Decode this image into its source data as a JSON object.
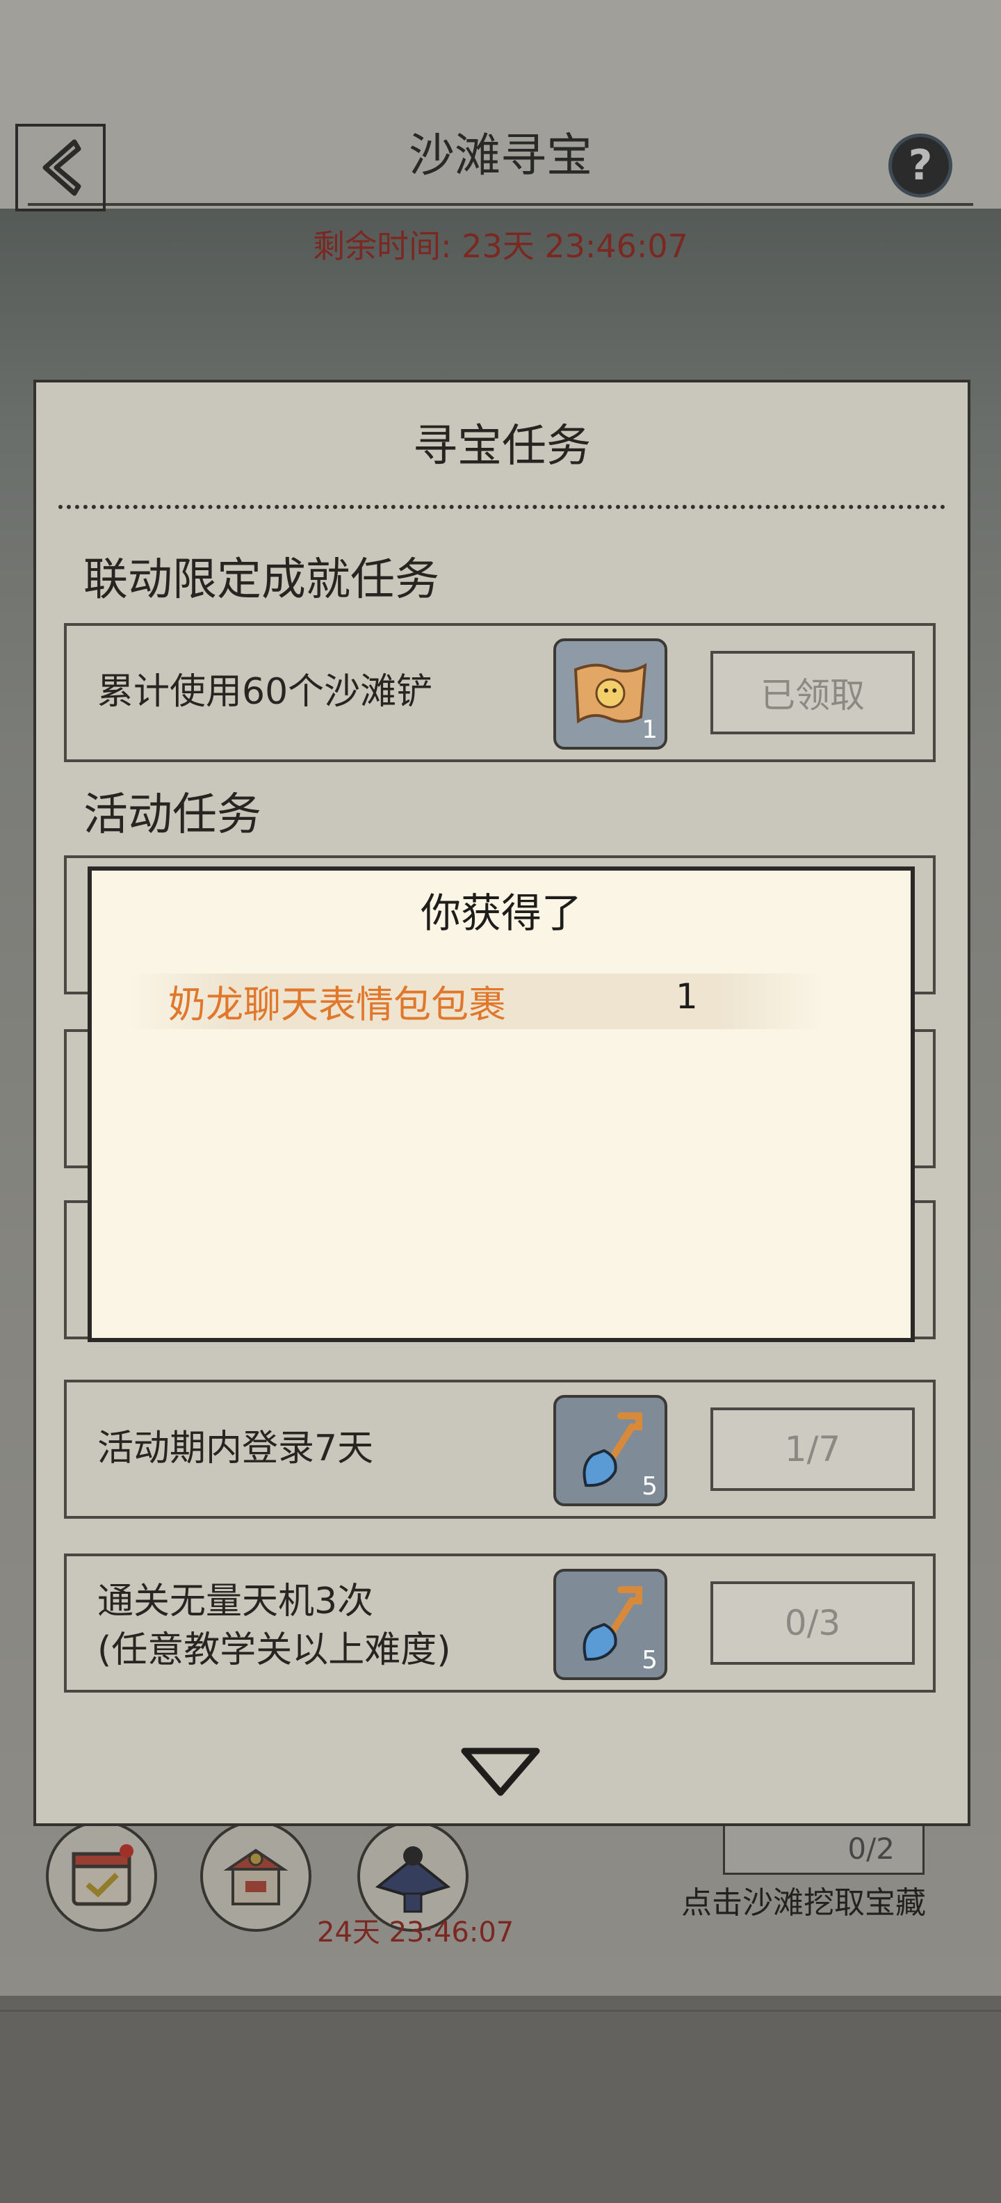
{
  "header": {
    "title": "沙滩寻宝",
    "help_symbol": "?",
    "back_icon": "back-arrow-icon"
  },
  "event": {
    "remaining_time": "剩余时间: 23天 23:46:07",
    "bottom_timer": "24天 23:46:07",
    "dig_tip": "点击沙滩挖取宝藏",
    "shovel_count": "0/2"
  },
  "panel": {
    "title": "寻宝任务",
    "section_limited": "联动限定成就任务",
    "section_event": "活动任务",
    "tasks": [
      {
        "label": "累计使用60个沙滩铲",
        "reward_icon": "treasure-map-icon",
        "reward_count": "1",
        "status": "已领取"
      },
      {
        "label": "活动期内登录7天",
        "reward_icon": "shovel-icon",
        "reward_count": "5",
        "status": "1/7"
      },
      {
        "label_line1": "通关无量天机3次",
        "label_line2": "(任意教学关以上难度)",
        "reward_icon": "shovel-icon",
        "reward_count": "5",
        "status": "0/3"
      }
    ]
  },
  "popup": {
    "title": "你获得了",
    "item_name": "奶龙聊天表情包包裹",
    "item_count": "1"
  },
  "colors": {
    "timer_red": "#a3291f",
    "item_orange": "#e0772b",
    "panel_bg": "#c9c6bc",
    "popup_bg": "#fbf5e6"
  }
}
